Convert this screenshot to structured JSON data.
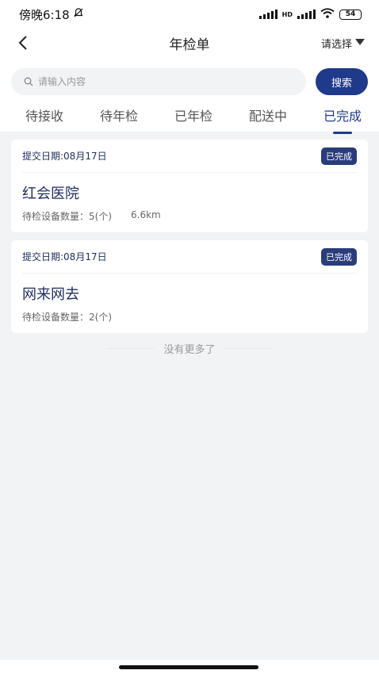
{
  "status_bar": {
    "time": "傍晚6:18",
    "network": "HD",
    "battery": "54"
  },
  "header": {
    "title": "年检单",
    "select_label": "请选择"
  },
  "search": {
    "placeholder": "请输入内容",
    "button_label": "搜索"
  },
  "tabs": [
    {
      "label": "待接收",
      "active": false
    },
    {
      "label": "待年检",
      "active": false
    },
    {
      "label": "已年检",
      "active": false
    },
    {
      "label": "配送中",
      "active": false
    },
    {
      "label": "已完成",
      "active": true
    }
  ],
  "orders": [
    {
      "date": "提交日期:08月17日",
      "status": "已完成",
      "name": "红会医院",
      "count": "待检设备数量：5(个)",
      "distance": "6.6km"
    },
    {
      "date": "提交日期:08月17日",
      "status": "已完成",
      "name": "网来网去",
      "count": "待检设备数量：2(个)",
      "distance": ""
    }
  ],
  "footer_text": "没有更多了",
  "colors": {
    "accent": "#1f3a8a",
    "badge": "#2a3d7a",
    "background": "#f2f3f5"
  },
  "icons": [
    "bell-off-icon",
    "signal-icon",
    "wifi-icon",
    "battery-icon",
    "back-arrow-icon",
    "caret-down-icon",
    "search-icon"
  ]
}
